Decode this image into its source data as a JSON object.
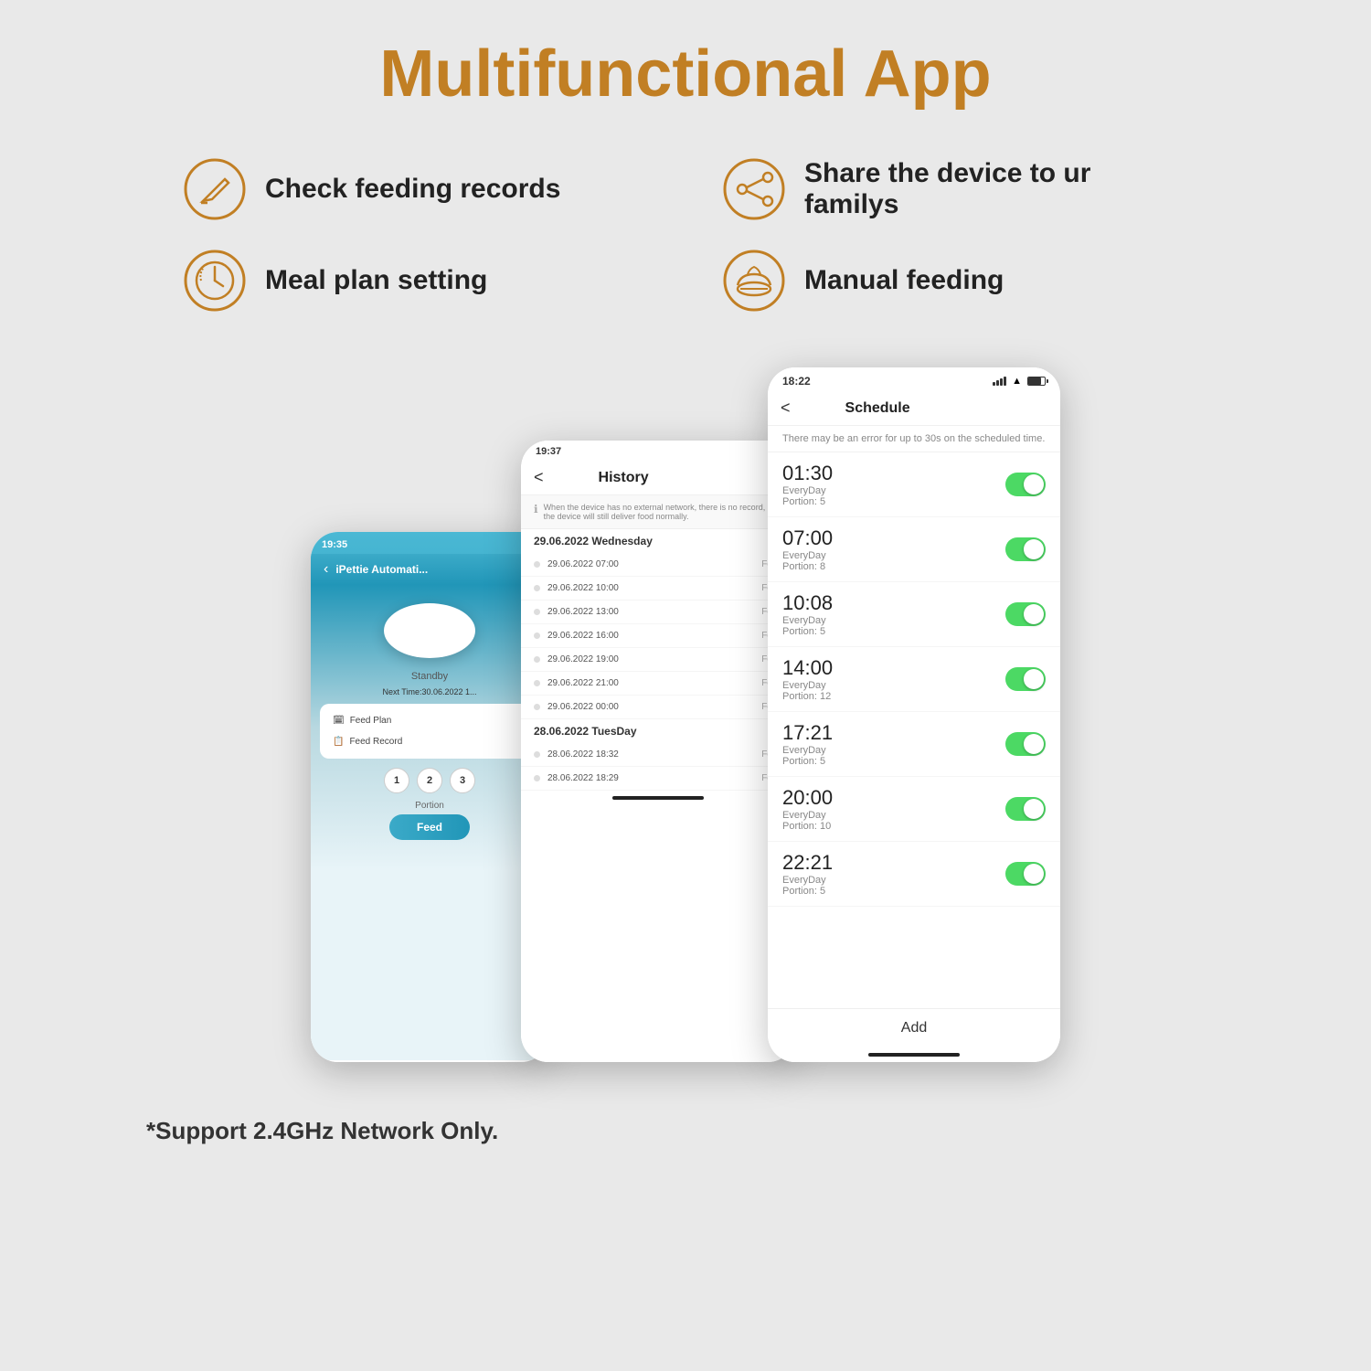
{
  "page": {
    "title": "Multifunctional App",
    "background_color": "#e9e9e9",
    "footnote": "*Support 2.4GHz Network Only."
  },
  "features": [
    {
      "id": "check-feeding",
      "icon": "edit-icon",
      "text": "Check feeding records"
    },
    {
      "id": "share-device",
      "icon": "share-icon",
      "text": "Share the device to ur familys"
    },
    {
      "id": "meal-plan",
      "icon": "clock-icon",
      "text": "Meal plan setting"
    },
    {
      "id": "manual-feeding",
      "icon": "bowl-icon",
      "text": "Manual feeding"
    }
  ],
  "phone1": {
    "status_time": "19:35",
    "title": "iPettie Automati...",
    "standby": "Standby",
    "next_time": "Next Time:30.06.2022 1...",
    "menu": [
      {
        "label": "Feed Plan"
      },
      {
        "label": "Feed Record"
      }
    ],
    "portions": [
      "1",
      "2",
      "3"
    ],
    "portion_label": "Portion",
    "feed_button": "Feed"
  },
  "phone2": {
    "status_time": "19:37",
    "title": "History",
    "back_label": "<",
    "info_text": "When the device has no external network, there is no record, but the device will still deliver food normally.",
    "date_groups": [
      {
        "date": "29.06.2022 Wednesday",
        "entries": [
          {
            "datetime": "29.06.2022 07:00",
            "label": "Feed"
          },
          {
            "datetime": "29.06.2022 10:00",
            "label": "Feed"
          },
          {
            "datetime": "29.06.2022 13:00",
            "label": "Feed"
          },
          {
            "datetime": "29.06.2022 16:00",
            "label": "Feed"
          },
          {
            "datetime": "29.06.2022 19:00",
            "label": "Feed"
          },
          {
            "datetime": "29.06.2022 21:00",
            "label": "Feed"
          },
          {
            "datetime": "29.06.2022 00:00",
            "label": "Feed"
          }
        ]
      },
      {
        "date": "28.06.2022 TuesDay",
        "entries": [
          {
            "datetime": "28.06.2022 18:32",
            "label": "Feed"
          },
          {
            "datetime": "28.06.2022 18:29",
            "label": "Feed"
          }
        ]
      }
    ]
  },
  "phone3": {
    "status_time": "18:22",
    "title": "Schedule",
    "back_label": "<",
    "info_text": "There may be an error for up to 30s on the scheduled time.",
    "schedules": [
      {
        "time": "01:30",
        "frequency": "EveryDay",
        "portion": "Portion: 5",
        "enabled": true
      },
      {
        "time": "07:00",
        "frequency": "EveryDay",
        "portion": "Portion: 8",
        "enabled": true
      },
      {
        "time": "10:08",
        "frequency": "EveryDay",
        "portion": "Portion: 5",
        "enabled": true
      },
      {
        "time": "14:00",
        "frequency": "EveryDay",
        "portion": "Portion: 12",
        "enabled": true
      },
      {
        "time": "17:21",
        "frequency": "EveryDay",
        "portion": "Portion: 5",
        "enabled": true
      },
      {
        "time": "20:00",
        "frequency": "EveryDay",
        "portion": "Portion: 10",
        "enabled": true
      },
      {
        "time": "22:21",
        "frequency": "EveryDay",
        "portion": "Portion: 5",
        "enabled": true
      }
    ],
    "add_button": "Add"
  }
}
